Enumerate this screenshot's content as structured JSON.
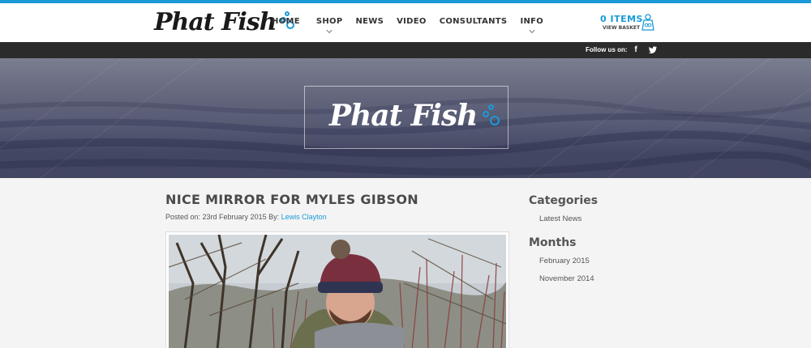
{
  "header": {
    "logo_text": "Phat Fish",
    "nav": [
      {
        "label": "HOME",
        "has_dropdown": false
      },
      {
        "label": "SHOP",
        "has_dropdown": true
      },
      {
        "label": "NEWS",
        "has_dropdown": false
      },
      {
        "label": "VIDEO",
        "has_dropdown": false
      },
      {
        "label": "CONSULTANTS",
        "has_dropdown": false
      },
      {
        "label": "INFO",
        "has_dropdown": true
      }
    ],
    "basket": {
      "count_label": "0 ITEMS",
      "sub_label": "VIEW BASKET",
      "icon": "basket-icon"
    }
  },
  "social_bar": {
    "follow_label": "Follow us on:",
    "icons": [
      "facebook-icon",
      "twitter-icon"
    ]
  },
  "banner": {
    "logo_text": "Phat Fish"
  },
  "post": {
    "title": "NICE MIRROR FOR MYLES GIBSON",
    "meta_prefix": "Posted on: 23rd February 2015 By:",
    "author": "Lewis Clayton"
  },
  "sidebar": {
    "categories_heading": "Categories",
    "categories": [
      "Latest News"
    ],
    "months_heading": "Months",
    "months": [
      "February 2015",
      "November 2014"
    ]
  },
  "colors": {
    "accent": "#1a9ad8",
    "dark_bar": "#2b2b2b",
    "page_bg": "#f4f4f4"
  }
}
